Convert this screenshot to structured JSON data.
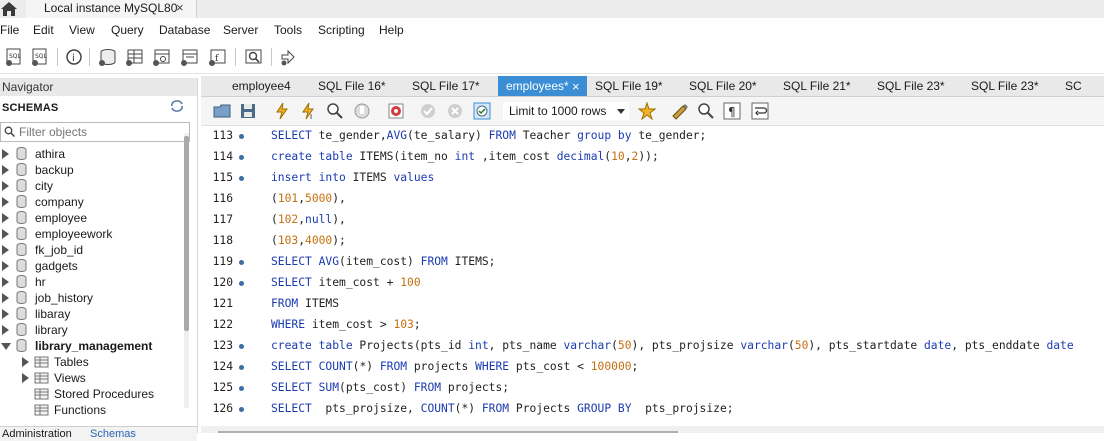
{
  "window": {
    "tab_title": "Local instance MySQL80",
    "tab_close": "×"
  },
  "menu": [
    "File",
    "Edit",
    "View",
    "Query",
    "Database",
    "Server",
    "Tools",
    "Scripting",
    "Help"
  ],
  "navigator": {
    "header": "Navigator",
    "schemas_label": "SCHEMAS",
    "filter_placeholder": "Filter objects",
    "schemas": [
      "athira",
      "backup",
      "city",
      "company",
      "employee",
      "employeework",
      "fk_job_id",
      "gadgets",
      "hr",
      "job_history",
      "libaray",
      "library"
    ],
    "expanded_schema": "library_management",
    "children": [
      "Tables",
      "Views",
      "Stored Procedures",
      "Functions"
    ],
    "bottom_tabs": [
      "Administration",
      "Schemas"
    ]
  },
  "editor_tabs": [
    {
      "label": "employee4",
      "active": false
    },
    {
      "label": "SQL File 16*",
      "active": false
    },
    {
      "label": "SQL File 17*",
      "active": false
    },
    {
      "label": "employees*",
      "active": true
    },
    {
      "label": "SQL File 19*",
      "active": false
    },
    {
      "label": "SQL File 20*",
      "active": false
    },
    {
      "label": "SQL File 21*",
      "active": false
    },
    {
      "label": "SQL File 23*",
      "active": false
    },
    {
      "label": "SQL File 23*",
      "active": false
    },
    {
      "label": "SC",
      "active": false
    }
  ],
  "active_tab_close": "×",
  "sql_toolbar": {
    "limit_label": "Limit to 1000 rows"
  },
  "code_lines": [
    {
      "num": "113",
      "dot": true,
      "text": "SELECT te_gender,AVG(te_salary) FROM Teacher group by te_gender;"
    },
    {
      "num": "114",
      "dot": true,
      "text": "create table ITEMS(item_no int ,item_cost decimal(10,2));"
    },
    {
      "num": "115",
      "dot": true,
      "text": "insert into ITEMS values"
    },
    {
      "num": "116",
      "dot": false,
      "text": "(101,5000),"
    },
    {
      "num": "117",
      "dot": false,
      "text": "(102,null),"
    },
    {
      "num": "118",
      "dot": false,
      "text": "(103,4000);"
    },
    {
      "num": "119",
      "dot": true,
      "text": "SELECT AVG(item_cost) FROM ITEMS;"
    },
    {
      "num": "120",
      "dot": true,
      "text": "SELECT item_cost + 100"
    },
    {
      "num": "121",
      "dot": false,
      "text": "FROM ITEMS"
    },
    {
      "num": "122",
      "dot": false,
      "text": "WHERE item_cost > 103;"
    },
    {
      "num": "123",
      "dot": true,
      "text": "create table Projects(pts_id int, pts_name varchar(50), pts_projsize varchar(50), pts_startdate date, pts_enddate date"
    },
    {
      "num": "124",
      "dot": true,
      "text": "SELECT COUNT(*) FROM projects WHERE pts_cost < 100000;"
    },
    {
      "num": "125",
      "dot": true,
      "text": "SELECT SUM(pts_cost) FROM projects;"
    },
    {
      "num": "126",
      "dot": true,
      "text": "SELECT  pts_projsize, COUNT(*) FROM Projects GROUP BY  pts_projsize;"
    }
  ],
  "colors": {
    "keyword": "#1c3bb0",
    "number": "#c5700f",
    "active_tab": "#3c8ed4"
  }
}
